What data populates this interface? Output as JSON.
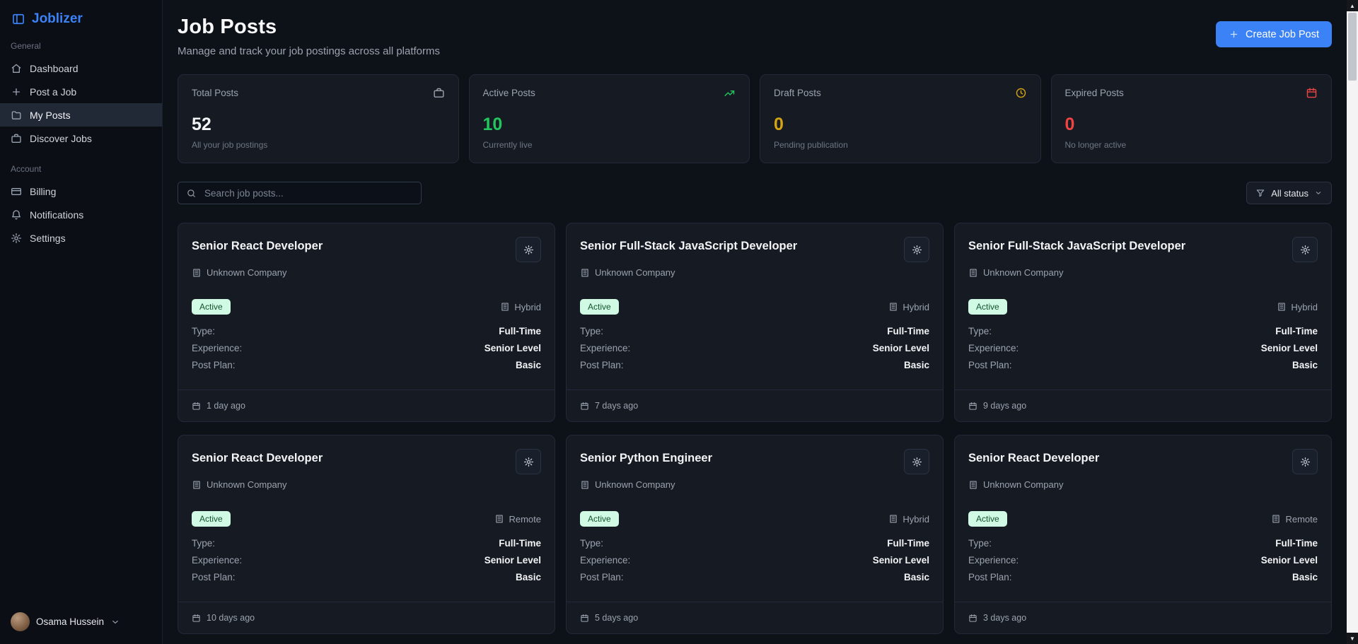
{
  "app": {
    "name": "Joblizer"
  },
  "sidebar": {
    "sections": [
      {
        "label": "General",
        "items": [
          {
            "label": "Dashboard"
          },
          {
            "label": "Post a Job"
          },
          {
            "label": "My Posts"
          },
          {
            "label": "Discover Jobs"
          }
        ]
      },
      {
        "label": "Account",
        "items": [
          {
            "label": "Billing"
          },
          {
            "label": "Notifications"
          },
          {
            "label": "Settings"
          }
        ]
      }
    ],
    "user": {
      "name": "Osama Hussein"
    }
  },
  "header": {
    "title": "Job Posts",
    "subtitle": "Manage and track your job postings across all platforms",
    "create_button_label": "Create Job Post"
  },
  "stats": [
    {
      "label": "Total Posts",
      "value": "52",
      "sub": "All your job postings"
    },
    {
      "label": "Active Posts",
      "value": "10",
      "sub": "Currently live"
    },
    {
      "label": "Draft Posts",
      "value": "0",
      "sub": "Pending publication"
    },
    {
      "label": "Expired Posts",
      "value": "0",
      "sub": "No longer active"
    }
  ],
  "toolbar": {
    "search_placeholder": "Search job posts...",
    "filter_label": "All status"
  },
  "jobs": {
    "labels": {
      "type": "Type:",
      "experience": "Experience:",
      "plan": "Post Plan:"
    },
    "cards": [
      {
        "title": "Senior React Developer",
        "company": "Unknown Company",
        "status": "Active",
        "work_mode": "Hybrid",
        "type": "Full-Time",
        "experience": "Senior Level",
        "plan": "Basic",
        "posted": "1 day ago"
      },
      {
        "title": "Senior Full-Stack JavaScript Developer",
        "company": "Unknown Company",
        "status": "Active",
        "work_mode": "Hybrid",
        "type": "Full-Time",
        "experience": "Senior Level",
        "plan": "Basic",
        "posted": "7 days ago"
      },
      {
        "title": "Senior Full-Stack JavaScript Developer",
        "company": "Unknown Company",
        "status": "Active",
        "work_mode": "Hybrid",
        "type": "Full-Time",
        "experience": "Senior Level",
        "plan": "Basic",
        "posted": "9 days ago"
      },
      {
        "title": "Senior React Developer",
        "company": "Unknown Company",
        "status": "Active",
        "work_mode": "Remote",
        "type": "Full-Time",
        "experience": "Senior Level",
        "plan": "Basic",
        "posted": "10 days ago"
      },
      {
        "title": "Senior Python Engineer",
        "company": "Unknown Company",
        "status": "Active",
        "work_mode": "Hybrid",
        "type": "Full-Time",
        "experience": "Senior Level",
        "plan": "Basic",
        "posted": "5 days ago"
      },
      {
        "title": "Senior React Developer",
        "company": "Unknown Company",
        "status": "Active",
        "work_mode": "Remote",
        "type": "Full-Time",
        "experience": "Senior Level",
        "plan": "Basic",
        "posted": "3 days ago"
      }
    ]
  },
  "colors": {
    "accent_blue": "#3b82f6",
    "active_green": "#22c55e",
    "draft_yellow": "#d6a410",
    "expired_red": "#ef4444",
    "badge_bg": "#d1fae5",
    "badge_text": "#14532d"
  }
}
